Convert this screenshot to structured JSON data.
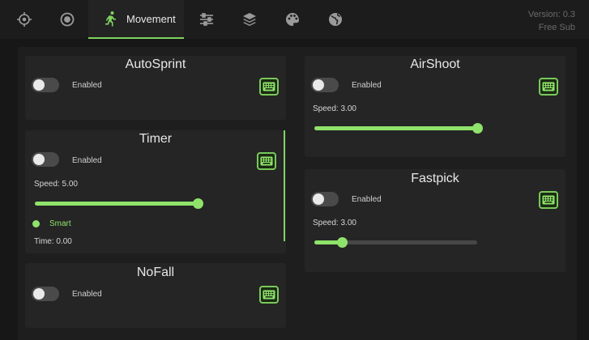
{
  "nav": {
    "icons": [
      "crosshair-icon",
      "eye-icon",
      "running-person-icon",
      "sliders-icon",
      "layers-icon",
      "palette-icon",
      "globe-icon"
    ],
    "active_tab_label": "Movement",
    "version": "Version: 0.3",
    "edition": "Free Sub"
  },
  "colors": {
    "accent": "#8fe36a",
    "background": "#171717",
    "card": "#252525"
  },
  "modules": {
    "autosprint": {
      "title": "AutoSprint",
      "enabled_label": "Enabled",
      "enabled": false
    },
    "timer": {
      "title": "Timer",
      "enabled_label": "Enabled",
      "enabled": false,
      "speed_label": "Speed: 5.00",
      "speed_value": 5.0,
      "speed_fraction": 0.99,
      "smart_label": "Smart",
      "time_label": "Time: 0.00"
    },
    "nofall": {
      "title": "NoFall",
      "enabled_label": "Enabled",
      "enabled": false
    },
    "airshoot": {
      "title": "AirShoot",
      "enabled_label": "Enabled",
      "enabled": false,
      "speed_label": "Speed: 3.00",
      "speed_value": 3.0,
      "speed_fraction": 1.0
    },
    "fastpick": {
      "title": "Fastpick",
      "enabled_label": "Enabled",
      "enabled": false,
      "speed_label": "Speed: 3.00",
      "speed_value": 3.0,
      "speed_fraction": 0.17
    }
  }
}
